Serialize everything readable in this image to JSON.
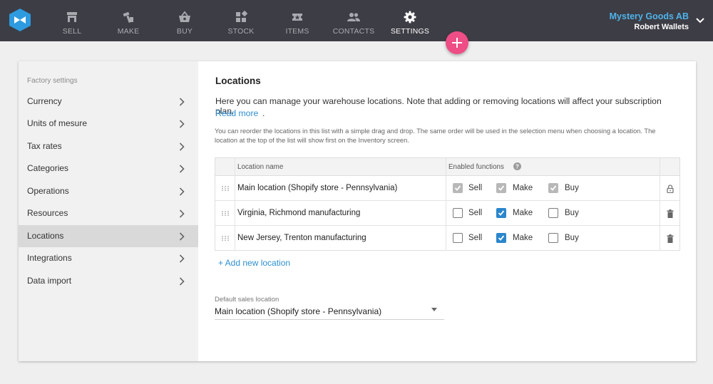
{
  "nav": {
    "items": [
      {
        "label": "SELL",
        "icon": "store-icon"
      },
      {
        "label": "MAKE",
        "icon": "hammer-icon"
      },
      {
        "label": "BUY",
        "icon": "basket-icon"
      },
      {
        "label": "STOCK",
        "icon": "boxes-icon"
      },
      {
        "label": "ITEMS",
        "icon": "ticket-icon"
      },
      {
        "label": "CONTACTS",
        "icon": "people-icon"
      },
      {
        "label": "SETTINGS",
        "icon": "gear-icon"
      }
    ],
    "active": "SETTINGS",
    "company": "Mystery Goods AB",
    "user": "Robert Wallets"
  },
  "colors": {
    "topbar": "#3d3d45",
    "accent": "#2e8fd1",
    "fab": "#ee4d86",
    "checkbox_checked": "#2a86cc"
  },
  "sidebar": {
    "heading": "Factory settings",
    "items": [
      {
        "label": "Currency"
      },
      {
        "label": "Units of mesure"
      },
      {
        "label": "Tax rates"
      },
      {
        "label": "Categories"
      },
      {
        "label": "Operations"
      },
      {
        "label": "Resources"
      },
      {
        "label": "Locations",
        "active": true
      },
      {
        "label": "Integrations"
      },
      {
        "label": "Data import"
      }
    ]
  },
  "main": {
    "title": "Locations",
    "description": "Here you can manage your warehouse locations. Note that adding or removing locations will affect your subscription plan.",
    "read_more": "Read more",
    "read_more_suffix": ".",
    "note": "You can reorder the locations in this list with a simple drag and drop. The same order will be used in the selection menu when choosing a location. The location at the top of the list will show first on the Inventory screen.",
    "table": {
      "col_name": "Location name",
      "col_functions": "Enabled functions",
      "rows": [
        {
          "name": "Main location (Shopify store - Pennsylvania)",
          "sell": true,
          "make": true,
          "buy": true,
          "locked": true,
          "action_icon": "lock-icon"
        },
        {
          "name": "Virginia, Richmond manufacturing",
          "sell": false,
          "make": true,
          "buy": false,
          "locked": false,
          "action_icon": "trash-icon"
        },
        {
          "name": "New Jersey, Trenton manufacturing",
          "sell": false,
          "make": true,
          "buy": false,
          "locked": false,
          "action_icon": "trash-icon"
        }
      ],
      "func_labels": {
        "sell": "Sell",
        "make": "Make",
        "buy": "Buy"
      }
    },
    "add_location": "+ Add new location",
    "default_sales": {
      "label": "Default sales location",
      "value": "Main location (Shopify store - Pennsylvania)"
    }
  }
}
